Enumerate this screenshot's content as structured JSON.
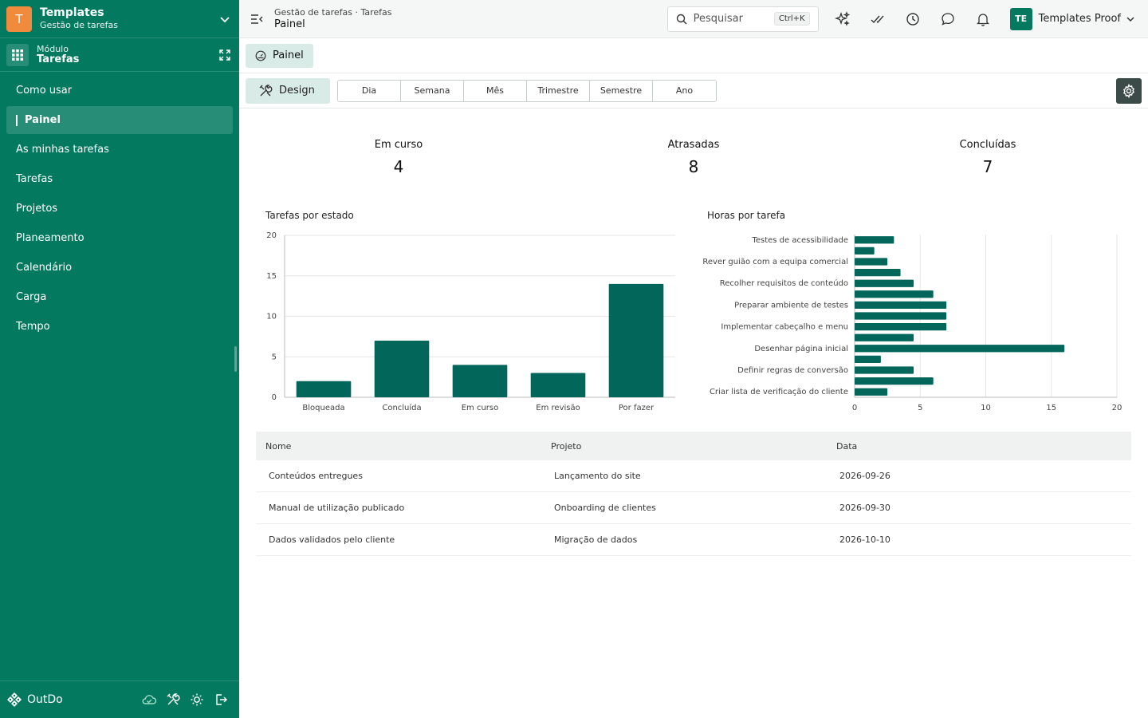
{
  "sidebar": {
    "app_badge": "T",
    "app_title": "Templates",
    "app_subtitle": "Gestão de tarefas",
    "module_label": "Módulo",
    "module_title": "Tarefas",
    "items": [
      {
        "label": "Como usar"
      },
      {
        "label": "Painel",
        "active": true
      },
      {
        "label": "As minhas tarefas"
      },
      {
        "label": "Tarefas"
      },
      {
        "label": "Projetos"
      },
      {
        "label": "Planeamento"
      },
      {
        "label": "Calendário"
      },
      {
        "label": "Carga"
      },
      {
        "label": "Tempo"
      }
    ],
    "brand": "OutDo"
  },
  "topbar": {
    "breadcrumb": "Gestão de tarefas · Tarefas",
    "page_title": "Painel",
    "search_placeholder": "Pesquisar",
    "search_shortcut": "Ctrl+K",
    "user_initials": "TE",
    "user_name": "Templates Proof"
  },
  "tabs": [
    {
      "label": "Painel"
    }
  ],
  "toolbar": {
    "design_label": "Design",
    "periods": [
      "Dia",
      "Semana",
      "Mês",
      "Trimestre",
      "Semestre",
      "Ano"
    ]
  },
  "kpis": [
    {
      "label": "Em curso",
      "value": "4"
    },
    {
      "label": "Atrasadas",
      "value": "8"
    },
    {
      "label": "Concluídas",
      "value": "7"
    }
  ],
  "chart_data": [
    {
      "type": "bar",
      "title": "Tarefas por estado",
      "categories": [
        "Bloqueada",
        "Concluída",
        "Em curso",
        "Em revisão",
        "Por fazer"
      ],
      "values": [
        2,
        7,
        4,
        3,
        14
      ],
      "ylim": [
        0,
        20
      ],
      "yticks": [
        0,
        5,
        10,
        15,
        20
      ],
      "grid": true,
      "color": "#03665a"
    },
    {
      "type": "bar",
      "orientation": "horizontal",
      "title": "Horas por tarefa",
      "categories": [
        "Testes de acessibilidade",
        "",
        "Rever guião com a equipa comercial",
        "",
        "Recolher requisitos de conteúdo",
        "",
        "Preparar ambiente de testes",
        "",
        "Implementar cabeçalho e menu",
        "",
        "Desenhar página inicial",
        "",
        "Definir regras de conversão",
        "",
        "Criar lista de verificação do cliente"
      ],
      "values": [
        3,
        1.5,
        2.5,
        3.5,
        4.5,
        6,
        7,
        7,
        7,
        4.5,
        16,
        2,
        4.5,
        6,
        2.5
      ],
      "xlim": [
        0,
        20
      ],
      "xticks": [
        0,
        5,
        10,
        15,
        20
      ],
      "grid": true,
      "color": "#03665a"
    }
  ],
  "table": {
    "columns": [
      "Nome",
      "Projeto",
      "Data"
    ],
    "rows": [
      [
        "Conteúdos entregues",
        "Lançamento do site",
        "2026-09-26"
      ],
      [
        "Manual de utilização publicado",
        "Onboarding de clientes",
        "2026-09-30"
      ],
      [
        "Dados validados pelo cliente",
        "Migração de dados",
        "2026-10-10"
      ]
    ]
  },
  "colors": {
    "sidebar_bg": "#03795f",
    "accent_light": "#d8ebe6",
    "bar": "#03665a",
    "app_badge": "#f08a3c"
  }
}
